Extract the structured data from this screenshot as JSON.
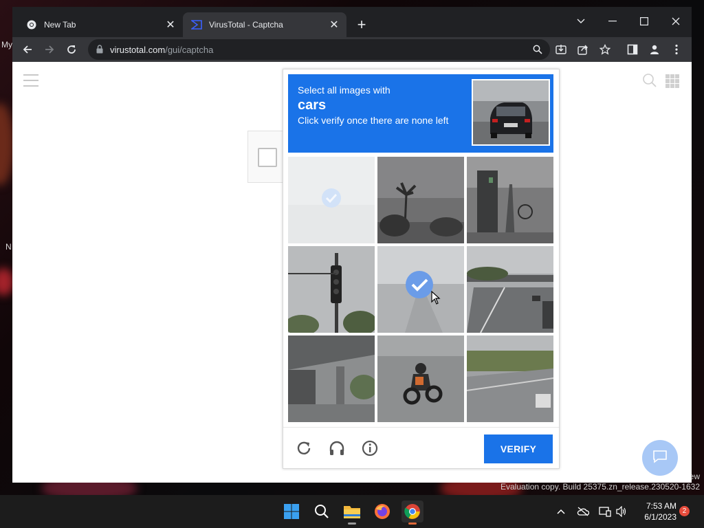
{
  "desktop": {
    "left_labels": [
      "My",
      "N"
    ],
    "watermark_partial": "ew",
    "watermark_build": "Evaluation copy. Build 25375.zn_release.230520-1632"
  },
  "browser": {
    "tabs": [
      {
        "label": "New Tab",
        "icon": "chrome-icon",
        "active": false
      },
      {
        "label": "VirusTotal - Captcha",
        "icon": "virustotal-icon",
        "active": true
      }
    ],
    "address": {
      "domain": "virustotal.com",
      "path": "/gui/captcha"
    }
  },
  "captcha": {
    "prompt_line1": "Select all images with",
    "target_word": "cars",
    "prompt_line2": "Click verify once there are none left",
    "tiles": [
      {
        "scene": "faded",
        "selected": true
      },
      {
        "scene": "palm-trees",
        "selected": false
      },
      {
        "scene": "street-post",
        "selected": false
      },
      {
        "scene": "traffic-light",
        "selected": false
      },
      {
        "scene": "road",
        "selected": true
      },
      {
        "scene": "overpass-road",
        "selected": false
      },
      {
        "scene": "bridge",
        "selected": false
      },
      {
        "scene": "motorcycle",
        "selected": false
      },
      {
        "scene": "highway-grass",
        "selected": false
      }
    ],
    "verify_label": "VERIFY"
  },
  "taskbar": {
    "time": "7:53 AM",
    "date": "6/1/2023",
    "notification_count": "2"
  },
  "colors": {
    "captcha_blue": "#1a73e8",
    "chrome_dark": "#202124",
    "chrome_toolbar": "#35363a"
  }
}
